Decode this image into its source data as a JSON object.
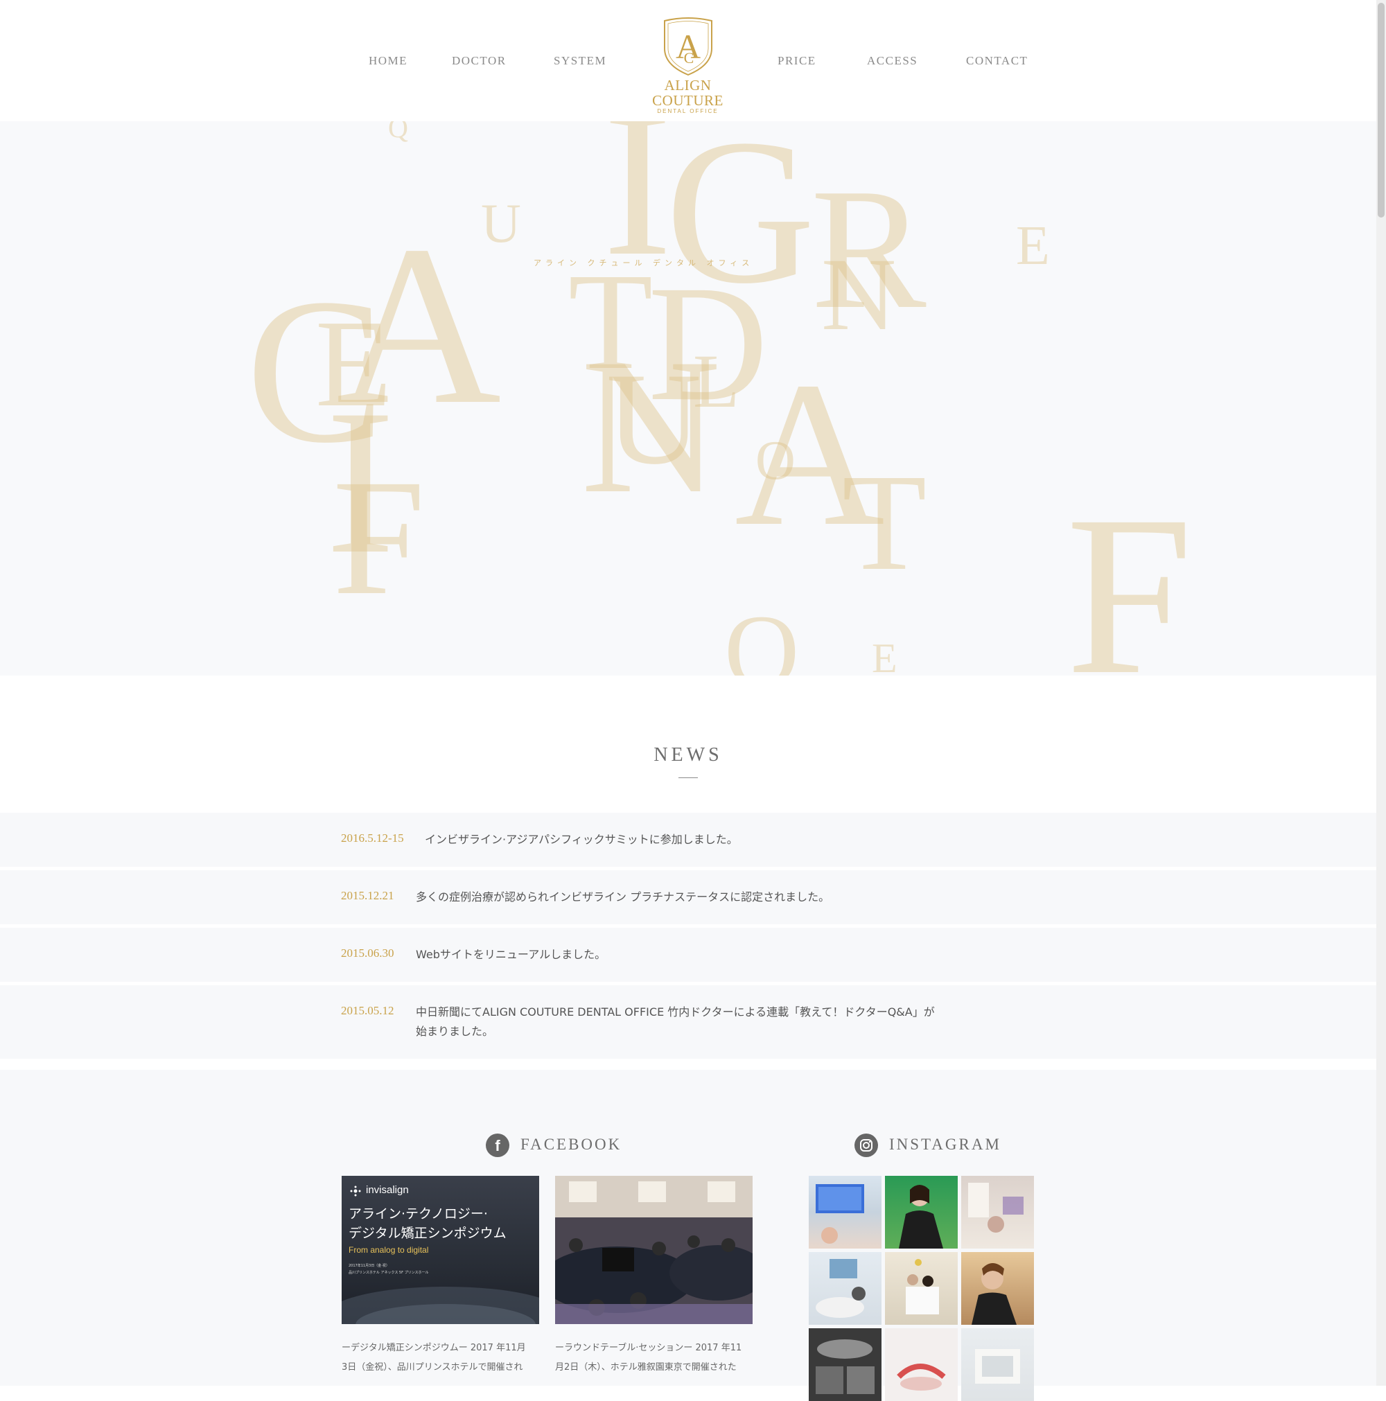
{
  "nav": {
    "left": [
      "HOME",
      "DOCTOR",
      "SYSTEM"
    ],
    "right": [
      "PRICE",
      "ACCESS",
      "CONTACT"
    ],
    "logo_title": "ALIGN COUTURE",
    "logo_sub": "DENTAL OFFICE",
    "logo_monogram": "AC"
  },
  "hero": {
    "kana": "アライン クチュール デンタル オフィス",
    "letters": [
      "I",
      "G",
      "R",
      "U",
      "E",
      "N",
      "C",
      "A",
      "T",
      "D",
      "E",
      "L",
      "U",
      "N",
      "O",
      "A",
      "T",
      "I",
      "F",
      "F",
      "O",
      "E",
      "Q"
    ]
  },
  "news": {
    "title": "NEWS",
    "items": [
      {
        "date": "2016.5.12-15",
        "text": "インビザライン·アジアパシフィックサミットに参加しました。"
      },
      {
        "date": "2015.12.21",
        "text": "多くの症例治療が認められインビザライン プラチナステータスに認定されました。"
      },
      {
        "date": "2015.06.30",
        "text": "Webサイトをリニューアルしました。"
      },
      {
        "date": "2015.05.12",
        "text": "中日新聞にてALIGN COUTURE DENTAL OFFICE 竹内ドクターによる連載「教えて！ドクターQ&A」が",
        "text2": "始まりました。"
      }
    ]
  },
  "facebook": {
    "title": "FACEBOOK",
    "icon": "facebook-icon",
    "posts": [
      {
        "brand": "invisalign",
        "headline1": "アライン·テクノロジー·",
        "headline2": "デジタル矯正シンポジウム",
        "subtitle": "From analog to digital",
        "detail1": "2017年11月3日（金·祝）",
        "detail2": "品川プリンスホテル アネックス 5F プリンスホール",
        "caption1": "ーデジタル矯正シンポジウムー 2017 年11月",
        "caption2": "3日（金祝）、品川プリンスホテルで開催され"
      },
      {
        "caption1": "ーラウンドテーブル·セッションー 2017 年11",
        "caption2": "月2日（木）、ホテル雅叙園東京で開催された"
      }
    ]
  },
  "instagram": {
    "title": "INSTAGRAM",
    "icon": "instagram-icon"
  },
  "colors": {
    "gold": "#c9a24a",
    "hero_letter": "#dec48c",
    "row_bg": "#f7f8fa"
  }
}
